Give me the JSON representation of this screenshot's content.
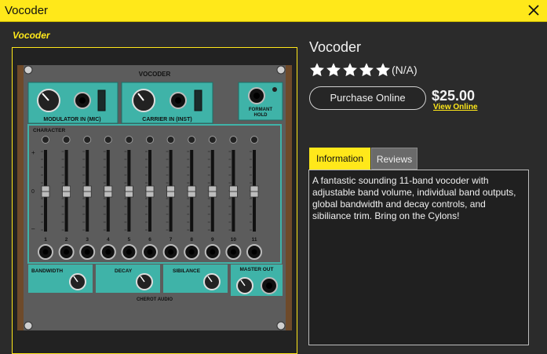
{
  "window": {
    "title": "Vocoder",
    "close_icon": "close-icon"
  },
  "product": {
    "subtitle": "Vocoder",
    "name": "Vocoder",
    "stars": 5,
    "star_color": "#ffffff",
    "rating": "(N/A)",
    "purchase_label": "Purchase Online",
    "price": "$25.00",
    "view_online": "View Online"
  },
  "tabs": {
    "information": "Information",
    "reviews": "Reviews",
    "active": "Information"
  },
  "description": "A fantastic sounding 11-band vocoder with adjustable band volume, individual band outputs, global bandwidth and decay controls, and sibiliance trim. Bring on the Cylons!",
  "module": {
    "title": "VOCODER",
    "modulator_label": "MODULATOR IN (MIC)",
    "carrier_label": "CARRIER IN (INST)",
    "formant_label_1": "FORMANT",
    "formant_label_2": "HOLD",
    "character_label": "CHARACTER",
    "plus": "+",
    "zero": "0",
    "minus": "–",
    "bands": [
      "1",
      "2",
      "3",
      "4",
      "5",
      "6",
      "7",
      "8",
      "9",
      "10",
      "11"
    ],
    "bandwidth_label": "BANDWIDTH",
    "decay_label": "DECAY",
    "sibilance_label": "SIBILANCE",
    "master_out_label": "MASTER OUT",
    "brand": "CHEROT AUDIO",
    "teal": "#3fb3a8",
    "panel_grey": "#5c5c5c"
  },
  "colors": {
    "accent": "#ffe81a",
    "bg": "#2b2b2b"
  }
}
